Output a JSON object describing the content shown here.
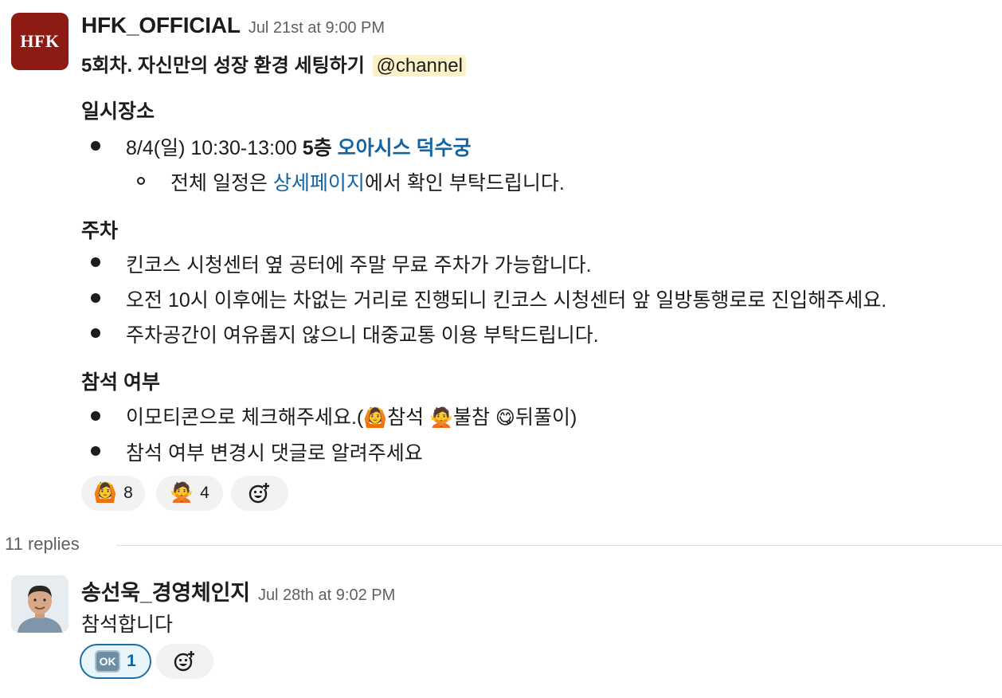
{
  "message1": {
    "author": "HFK_OFFICIAL",
    "avatar_text": "HFK",
    "timestamp": "Jul 21st at 9:00 PM",
    "title": "5회차. 자신만의 성장 환경 세팅하기",
    "mention": "@channel",
    "sections": {
      "when_where": {
        "heading": "일시장소",
        "item1_prefix": "8/4(일) 10:30-13:00 ",
        "item1_bold": "5층",
        "item1_link": "오아시스 덕수궁",
        "sub_before": "전체 일정은 ",
        "sub_link": "상세페이지",
        "sub_after": "에서 확인 부탁드립니다."
      },
      "parking": {
        "heading": "주차",
        "items": [
          "킨코스 시청센터 옆 공터에 주말 무료 주차가 가능합니다.",
          "오전 10시 이후에는 차없는 거리로 진행되니 킨코스 시청센터 앞 일방통행로로 진입해주세요.",
          "주차공간이 여유롭지 않으니 대중교통 이용 부탁드립니다."
        ]
      },
      "attendance": {
        "heading": "참석 여부",
        "item1_a": "이모티콘으로 체크해주세요.(",
        "item1_b": "참석 ",
        "item1_c": "불참 ",
        "item1_d": "뒤풀이)",
        "item2": "참석 여부 변경시 댓글로 알려주세요"
      }
    },
    "reactions": [
      {
        "emoji": "🙆",
        "count": "8"
      },
      {
        "emoji": "🙅",
        "count": "4"
      }
    ],
    "emoji_yum": "😋"
  },
  "thread": {
    "replies_label": "11 replies"
  },
  "message2": {
    "author": "송선욱_경영체인지",
    "timestamp": "Jul 28th at 9:02 PM",
    "text": "참석합니다",
    "reactions": [
      {
        "emoji": "OK",
        "count": "1"
      }
    ]
  },
  "colors": {
    "link": "#1264a3",
    "mention_bg": "#fdf1c7",
    "avatar_bg": "#8e1a14",
    "active_reaction_border": "#1d6ea8"
  }
}
